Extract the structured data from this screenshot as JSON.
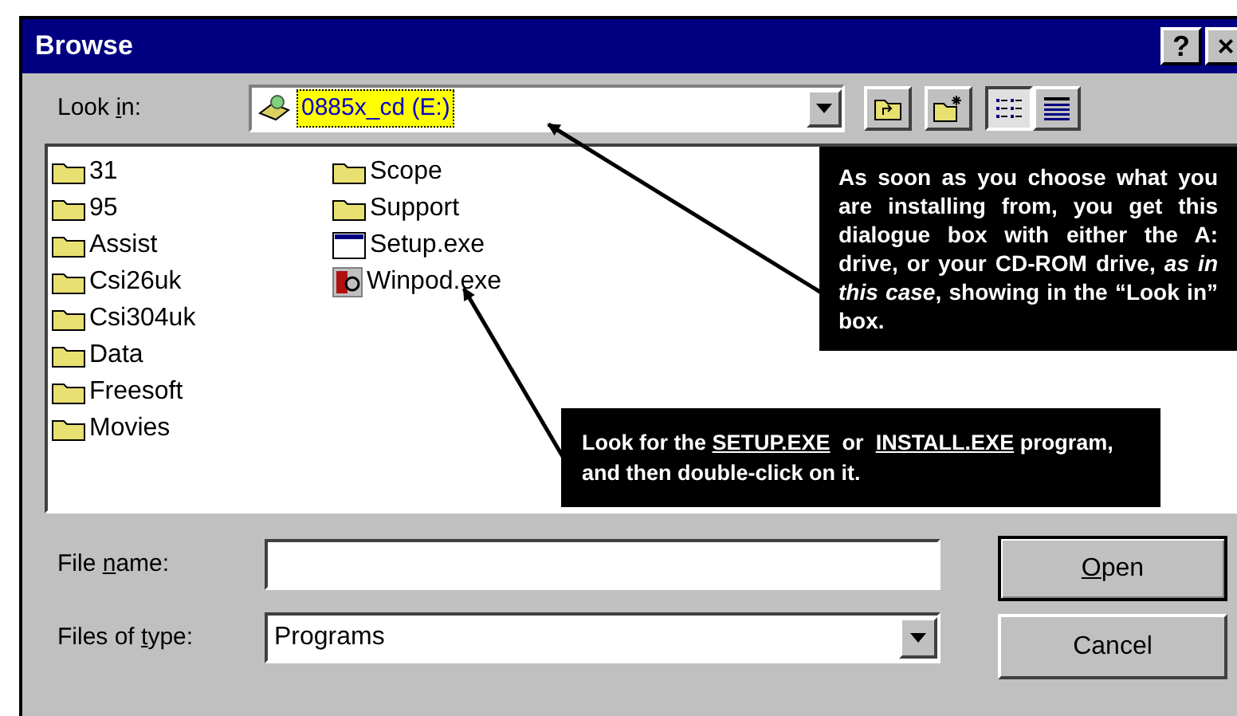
{
  "window": {
    "title": "Browse",
    "title_buttons": [
      "?",
      "×"
    ]
  },
  "look_in": {
    "label": {
      "before": "Look ",
      "mnemonic": "i",
      "after": "n:"
    },
    "value": "0885x_cd (E:)"
  },
  "toolbar": [
    {
      "kind": "up-folder",
      "selected": false
    },
    {
      "kind": "new-folder",
      "selected": false
    },
    {
      "kind": "list-view",
      "selected": true
    },
    {
      "kind": "details-view",
      "selected": false
    }
  ],
  "files": {
    "columns": [
      [
        {
          "name": "31",
          "kind": "folder"
        },
        {
          "name": "95",
          "kind": "folder"
        },
        {
          "name": "Assist",
          "kind": "folder"
        },
        {
          "name": "Csi26uk",
          "kind": "folder"
        },
        {
          "name": "Csi304uk",
          "kind": "folder"
        },
        {
          "name": "Data",
          "kind": "folder"
        },
        {
          "name": "Freesoft",
          "kind": "folder"
        },
        {
          "name": "Movies",
          "kind": "folder"
        }
      ],
      [
        {
          "name": "Scope",
          "kind": "folder"
        },
        {
          "name": "Support",
          "kind": "folder"
        },
        {
          "name": "Setup.exe",
          "kind": "window-program"
        },
        {
          "name": "Winpod.exe",
          "kind": "app-program"
        }
      ]
    ]
  },
  "file_name": {
    "label": {
      "before": "File ",
      "mnemonic": "n",
      "after": "ame:"
    }
  },
  "file_type": {
    "label": {
      "before": "Files of ",
      "mnemonic": "t",
      "after": "ype:"
    },
    "value": "Programs"
  },
  "buttons": [
    {
      "label": {
        "mnemonic": "O",
        "after": "pen"
      },
      "default": true
    },
    {
      "label": {
        "before": "Cancel"
      },
      "default": false
    }
  ],
  "callouts": [
    {
      "parts": [
        {
          "text": "As soon as you choose what you are installing from, you get this dialogue box with either the  A:  drive, or your CD-ROM drive, *as in this case*, showing in the  “Look in”  box.",
          "underline": false
        }
      ]
    },
    {
      "parts": [
        {
          "text": "Look for the ",
          "underline": false
        },
        {
          "text": "SETUP.EXE",
          "underline": true
        },
        {
          "text": "  or  ",
          "underline": false
        },
        {
          "text": "INSTALL.EXE",
          "underline": true
        },
        {
          "text": " program, and then double-click on it.",
          "underline": false
        }
      ]
    }
  ]
}
